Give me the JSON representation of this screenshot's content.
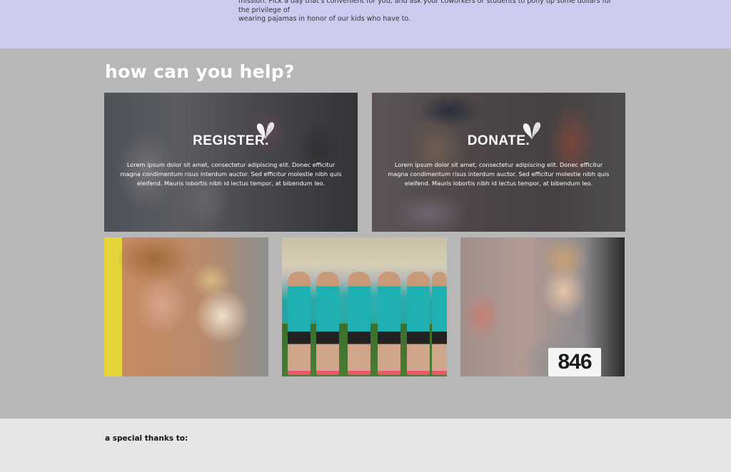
{
  "top": {
    "intro_lines": [
      "mission. Pick a day that's convenient for you, and ask your coworkers or students to pony up some dollars for the privilege of",
      "wearing pajamas in honor of our kids who have to."
    ]
  },
  "help": {
    "title": "how can you help?",
    "cards": [
      {
        "title": "REGISTER.",
        "body": "Lorem ipsum dolor sit amet, consectetur adipiscing elit. Donec efficitur magna condimentum risus interdum auctor. Sed efficitur molestie nibh quis eleifend. Mauris lobortis nibh id lectus tempor, at bibendum leo."
      },
      {
        "title": "DONATE.",
        "body": "Lorem ipsum dolor sit amet, consectetur adipiscing elit. Donec efficitur magna condimentum risus interdum auctor. Sed efficitur molestie nibh quis eleifend. Mauris lobortis nibh id lectus tempor, at bibendum leo."
      }
    ],
    "photos": [
      {
        "name": "volunteer-with-child-photo"
      },
      {
        "name": "girls-team-photo"
      },
      {
        "name": "boy-runner-photo",
        "bib": "846"
      }
    ],
    "icon": "butterfly-icon"
  },
  "footer": {
    "thanks": "a special thanks to:"
  },
  "colors": {
    "top_band": "#cbcbf0",
    "help_band": "#b7b7b7",
    "thanks_band": "#e5e5e8"
  }
}
